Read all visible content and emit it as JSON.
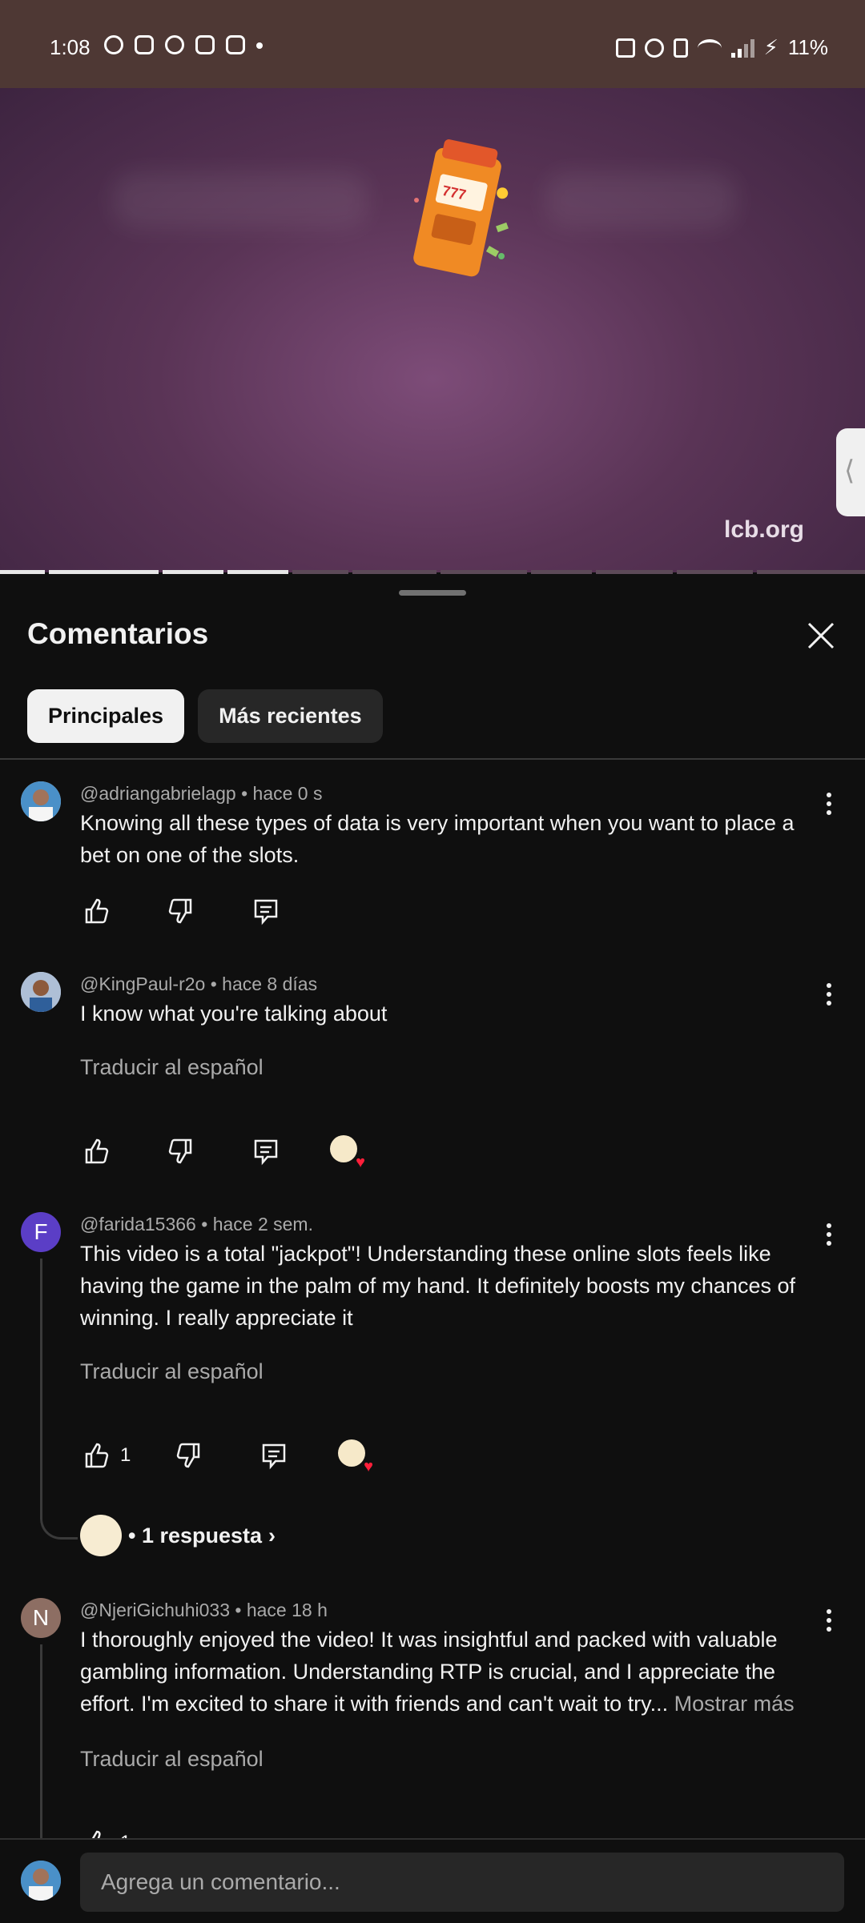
{
  "status_bar": {
    "time": "1:08",
    "battery": "11%",
    "app_icons": [
      "whatsapp-icon",
      "discord-icon",
      "messenger-icon",
      "instagram-icon",
      "instagram-icon"
    ]
  },
  "video": {
    "watermark": "lcb.org",
    "progress_segments_done": 4,
    "progress_segments_total": 11
  },
  "sheet": {
    "title": "Comentarios",
    "chips": [
      {
        "label": "Principales",
        "active": true
      },
      {
        "label": "Más recientes",
        "active": false
      }
    ]
  },
  "comments": [
    {
      "author": "@adriangabrielagp",
      "time": "hace 0 s",
      "text": "Knowing all these types of data is very important when you want to place a bet on one of the slots."
    },
    {
      "author": "@KingPaul-r2o",
      "time": "hace 8 días",
      "text": "I know what you're talking about",
      "translate": "Traducir al español"
    },
    {
      "author": "@farida15366",
      "avatar_letter": "F",
      "avatar_color": "#5b3ec6",
      "time": "hace 2 sem.",
      "text": "This video is a total \"jackpot\"! Understanding these online slots feels like having the game in the palm of my hand. It definitely boosts my chances of winning. I really appreciate it",
      "translate": "Traducir al español",
      "likes": "1",
      "replies": "• 1 respuesta"
    },
    {
      "author": "@NjeriGichuhi033",
      "avatar_letter": "N",
      "avatar_color": "#8d6e63",
      "time": "hace 18 h",
      "text": "I thoroughly enjoyed the video! It was insightful and packed with valuable gambling information. Understanding RTP is crucial, and I appreciate the effort. I'm excited to share it with friends and can't wait to try...",
      "more": "Mostrar más",
      "translate": "Traducir al español",
      "likes": "1"
    }
  ],
  "composer": {
    "placeholder": "Agrega un comentario..."
  },
  "colors": {
    "background": "#0f0f0f",
    "status_bar": "#4e3834",
    "chip_active": "#f1f1f1",
    "chip_inactive": "#272727",
    "heart": "#ff1f3a"
  }
}
